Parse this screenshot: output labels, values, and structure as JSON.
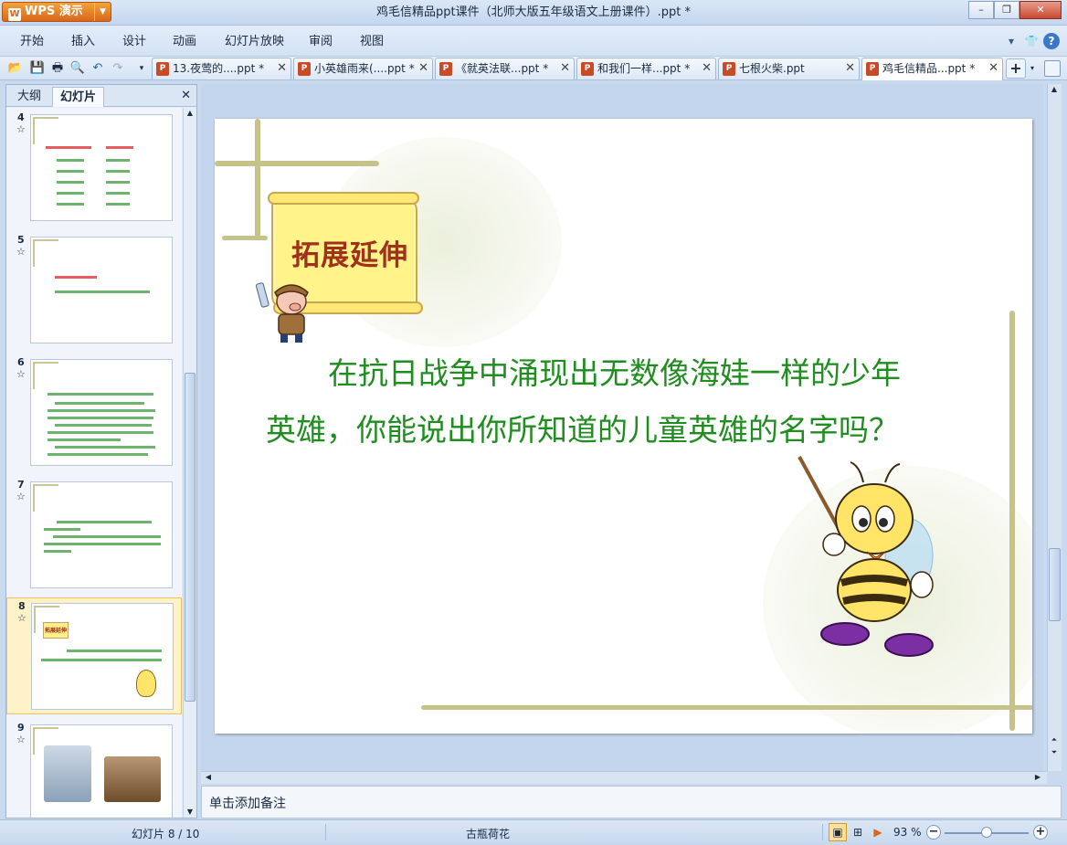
{
  "app": {
    "name": "WPS 演示",
    "logo_glyph": "W"
  },
  "window": {
    "title": "鸡毛信精品ppt课件（北师大版五年级语文上册课件）.ppt *",
    "controls": [
      "minimize",
      "maximize",
      "close"
    ]
  },
  "menu": {
    "items": [
      "开始",
      "插入",
      "设计",
      "动画",
      "幻灯片放映",
      "审阅",
      "视图"
    ],
    "right_icons": [
      "chevron-down-icon",
      "skin-icon",
      "help-icon"
    ]
  },
  "quick_access": [
    "open-icon",
    "save-icon",
    "print-icon",
    "print-preview-icon",
    "undo-icon",
    "redo-icon",
    "customize-icon"
  ],
  "doc_tabs": [
    {
      "label": "13.夜莺的....ppt *",
      "active": false
    },
    {
      "label": "小英雄雨来(....ppt *",
      "active": false
    },
    {
      "label": "《就英法联...ppt *",
      "active": false
    },
    {
      "label": "和我们一样...ppt *",
      "active": false
    },
    {
      "label": "七根火柴.ppt",
      "active": false
    },
    {
      "label": "鸡毛信精品...ppt *",
      "active": true
    }
  ],
  "left_panel": {
    "tabs": [
      "大纲",
      "幻灯片"
    ],
    "active_tab": "幻灯片",
    "slides": [
      {
        "num": "4",
        "selected": false
      },
      {
        "num": "5",
        "selected": false
      },
      {
        "num": "6",
        "selected": false
      },
      {
        "num": "7",
        "selected": false
      },
      {
        "num": "8",
        "selected": true,
        "badge": "拓展延伸"
      },
      {
        "num": "9",
        "selected": false
      }
    ]
  },
  "slide": {
    "banner": "拓展延伸",
    "line1": "在抗日战争中涌现出无数像海娃一样的少年",
    "line2": "英雄，你能说出你所知道的儿童英雄的名字吗？"
  },
  "notes": {
    "placeholder": "单击添加备注"
  },
  "status": {
    "slide_indicator": "幻灯片 8 / 10",
    "theme": "古瓶荷花",
    "zoom": "93 %",
    "zoom_fraction": 0.5
  },
  "colors": {
    "accent": "#d9661a",
    "slide_text": "#1f8d1f",
    "banner_text": "#a1301c",
    "banner_fill": "#fff38a"
  }
}
